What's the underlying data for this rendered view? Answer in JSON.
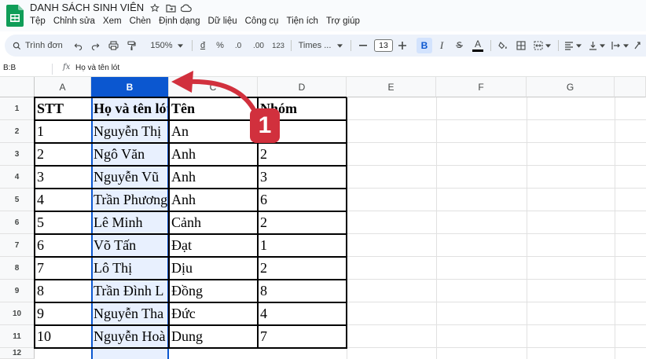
{
  "app": {
    "title": "DANH SÁCH SINH VIÊN",
    "menu": [
      "Tệp",
      "Chỉnh sửa",
      "Xem",
      "Chèn",
      "Định dạng",
      "Dữ liệu",
      "Công cụ",
      "Tiện ích",
      "Trợ giúp"
    ]
  },
  "toolbar": {
    "search_label": "Trình đơn",
    "zoom": "150%",
    "currency": "đ",
    "percent": "%",
    "dec_decrease": ".0",
    "dec_increase": ".00",
    "number_format": "123",
    "font": "Times ...",
    "font_size": "13",
    "bold": "B",
    "italic": "I",
    "underline_color": "A"
  },
  "formula_bar": {
    "name_box": "B:B",
    "fx": "fx",
    "value": "Họ và tên lót"
  },
  "columns": [
    "A",
    "B",
    "C",
    "D",
    "E",
    "F",
    "G"
  ],
  "rows": [
    "1",
    "2",
    "3",
    "4",
    "5",
    "6",
    "7",
    "8",
    "9",
    "10",
    "11",
    "12"
  ],
  "table": {
    "header": [
      "STT",
      "Họ và tên lót",
      "Tên",
      "Nhóm"
    ],
    "body": [
      [
        "1",
        "Nguyễn Thị",
        "An",
        ""
      ],
      [
        "2",
        "Ngô Văn",
        "Anh",
        "2"
      ],
      [
        "3",
        "Nguyễn Vũ",
        "Anh",
        "3"
      ],
      [
        "4",
        "Trần Phương",
        "Anh",
        "6"
      ],
      [
        "5",
        "Lê Minh",
        "Cảnh",
        "2"
      ],
      [
        "6",
        "Võ Tấn",
        "Đạt",
        "1"
      ],
      [
        "7",
        "Lô Thị",
        "Dịu",
        "2"
      ],
      [
        "8",
        "Trần Đình L",
        "Đồng",
        "8"
      ],
      [
        "9",
        "Nguyễn Tha",
        "Đức",
        "4"
      ],
      [
        "10",
        "Nguyễn Hoà",
        "Dung",
        "7"
      ]
    ]
  },
  "annotation": {
    "badge": "1",
    "color": "#d1303d"
  },
  "colors": {
    "accent": "#0b57d0",
    "selection_fill": "#e8f0fe",
    "toolbar_bg": "#edf2fa"
  }
}
